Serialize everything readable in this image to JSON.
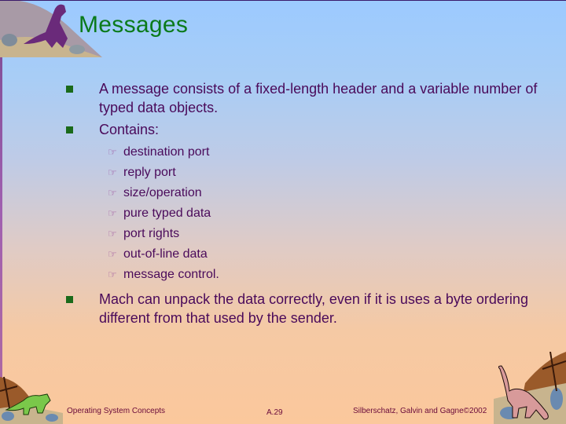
{
  "slide": {
    "title": "Messages",
    "bullets": [
      {
        "text": "A message consists of a fixed-length header and a variable number of typed data objects."
      },
      {
        "text": "Contains:",
        "subitems": [
          "destination port",
          "reply port",
          "size/operation",
          "pure typed data",
          "port rights",
          "out-of-line data",
          "message control."
        ]
      },
      {
        "text": "Mach can unpack the data correctly, even if it is uses a byte ordering different from that used by the sender."
      }
    ],
    "bullet_icon": "square-bullet-icon",
    "sub_bullet_icon": "pointing-hand-icon",
    "sub_bullet_glyph": "☞"
  },
  "footer": {
    "left": "Operating System Concepts",
    "center": "A.29",
    "right": "Silberschatz, Galvin and  Gagne©2002"
  },
  "colors": {
    "title": "#0a7a1a",
    "body_text": "#4a0a5a",
    "bullet": "#1a6a1a",
    "background_top": "#9ccaff",
    "background_bottom": "#fbc89c"
  }
}
